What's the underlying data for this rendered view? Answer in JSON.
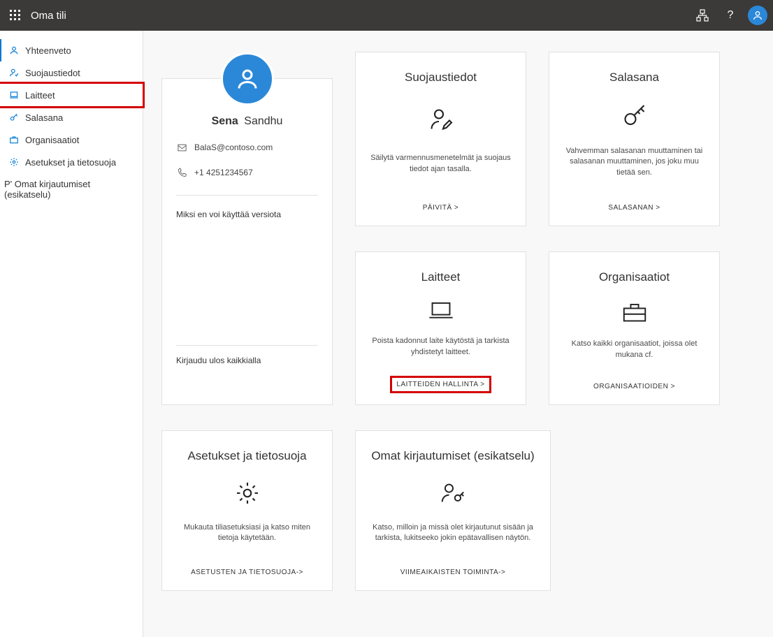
{
  "header": {
    "title": "Oma tili"
  },
  "sidebar": {
    "items": [
      {
        "label": "Yhteenveto"
      },
      {
        "label": "Suojaustiedot"
      },
      {
        "label": "Laitteet"
      },
      {
        "label": "Salasana"
      },
      {
        "label": "Organisaatiot"
      },
      {
        "label": "Asetukset ja tietosuoja"
      },
      {
        "label": "P' Omat kirjautumiset (esikatselu)"
      }
    ]
  },
  "profile": {
    "first_name": "Sena",
    "last_name": "Sandhu",
    "email": "BalaS@contoso.com",
    "phone": "+1 4251234567",
    "why_link": "Miksi en voi käyttää versiota",
    "signout": "Kirjaudu ulos kaikkialla"
  },
  "cards": {
    "security": {
      "title": "Suojaustiedot",
      "desc": "Säilytä varmennusmenetelmät ja suojaus tiedot ajan tasalla.",
      "action": "PÄIVITÄ &gt;"
    },
    "password": {
      "title": "Salasana",
      "desc": "Vahvemman salasanan muuttaminen tai salasanan muuttaminen, jos joku muu tietää sen.",
      "action": "SALASANAN &gt;"
    },
    "devices": {
      "title": "Laitteet",
      "desc": "Poista kadonnut laite käytöstä ja tarkista yhdistetyt laitteet.",
      "action": "LAITTEIDEN HALLINTA &gt;"
    },
    "orgs": {
      "title": "Organisaatiot",
      "desc": "Katso kaikki organisaatiot, joissa olet mukana cf.",
      "action": "ORGANISAATIOIDEN &gt;"
    },
    "settings": {
      "title": "Asetukset ja tietosuoja",
      "desc": "Mukauta tiliasetuksiasi ja katso miten tietoja käytetään.",
      "action": "ASETUSTEN JA TIETOSUOJA-&gt;"
    },
    "signins": {
      "title": "Omat kirjautumiset (esikatselu)",
      "desc": "Katso, milloin ja missä olet kirjautunut sisään ja tarkista, lukitseeko jokin epätavallisen näytön.",
      "action": "VIIMEAIKAISTEN TOIMINTA-&gt;"
    }
  }
}
